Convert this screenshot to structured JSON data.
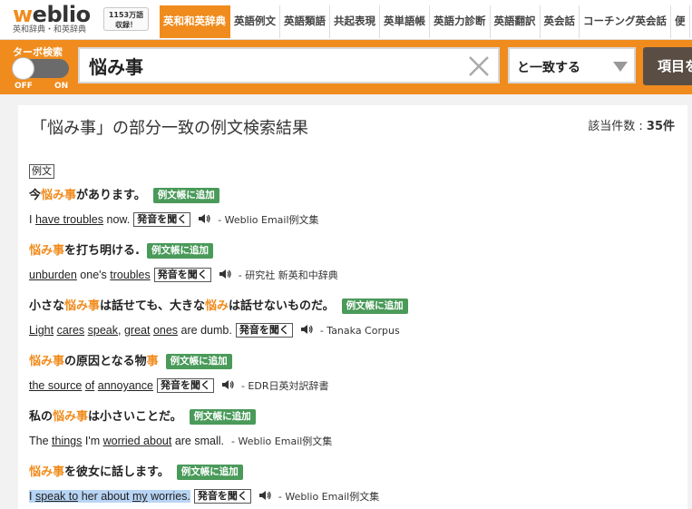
{
  "logo": {
    "brand_w": "w",
    "brand_rest": "eblio",
    "subtitle": "英和辞典・和英辞典"
  },
  "badge": {
    "line1": "1153万語",
    "line2": "収録！"
  },
  "nav": {
    "tabs": [
      "英和和英辞典",
      "英語例文",
      "英語類語",
      "共起表現",
      "英単語帳",
      "英語力診断",
      "英語翻訳",
      "英会話",
      "コーチング英会話",
      "便"
    ],
    "active_index": 0
  },
  "search": {
    "turbo_label": "ターボ検索",
    "toggle_off": "OFF",
    "toggle_on": "ON",
    "turbo_state": "off",
    "query": "悩み事",
    "match_mode": "と一致する",
    "item_button": "項目を"
  },
  "results": {
    "title": "「悩み事」の部分一致の例文検索結果",
    "count_label": "該当件数 : ",
    "count_value": "35件",
    "section_label": "例文",
    "add_label": "例文帳に追加",
    "listen_label": "発音を聞く",
    "entries": [
      {
        "jp": [
          {
            "t": "今"
          },
          {
            "t": "悩み事",
            "hl": true
          },
          {
            "t": "があります。"
          }
        ],
        "en": [
          {
            "t": "I "
          },
          {
            "t": "have troubles",
            "u": true
          },
          {
            "t": " now."
          }
        ],
        "source": "- Weblio Email例文集"
      },
      {
        "jp": [
          {
            "t": "悩み事",
            "hl": true
          },
          {
            "t": "を打ち明ける."
          }
        ],
        "en": [
          {
            "t": "unburden",
            "u": true
          },
          {
            "t": " one's "
          },
          {
            "t": "troubles",
            "u": true
          }
        ],
        "source": "- 研究社 新英和中辞典"
      },
      {
        "jp": [
          {
            "t": "小さな"
          },
          {
            "t": "悩み事",
            "hl": true
          },
          {
            "t": "は話せても、大きな"
          },
          {
            "t": "悩み",
            "hl": true
          },
          {
            "t": "は話せないものだ。"
          }
        ],
        "en": [
          {
            "t": "Light",
            "u": true
          },
          {
            "t": " "
          },
          {
            "t": "cares",
            "u": true
          },
          {
            "t": " "
          },
          {
            "t": "speak",
            "u": true
          },
          {
            "t": ", "
          },
          {
            "t": "great",
            "u": true
          },
          {
            "t": " "
          },
          {
            "t": "ones",
            "u": true
          },
          {
            "t": " are dumb."
          }
        ],
        "source": "- Tanaka Corpus"
      },
      {
        "jp": [
          {
            "t": "悩み事",
            "hl": true
          },
          {
            "t": "の原因となる物"
          },
          {
            "t": "事",
            "hl": true
          }
        ],
        "en": [
          {
            "t": "the source",
            "u": true
          },
          {
            "t": " "
          },
          {
            "t": "of",
            "u": true
          },
          {
            "t": " "
          },
          {
            "t": "annoyance",
            "u": true
          }
        ],
        "source": "- EDR日英対訳辞書"
      },
      {
        "jp": [
          {
            "t": "私の"
          },
          {
            "t": "悩み事",
            "hl": true
          },
          {
            "t": "は小さいことだ。"
          }
        ],
        "en": [
          {
            "t": "The "
          },
          {
            "t": "things",
            "u": true
          },
          {
            "t": " I'm "
          },
          {
            "t": "worried about",
            "u": true
          },
          {
            "t": " are small."
          }
        ],
        "source": "- Weblio Email例文集",
        "no_listen": true
      },
      {
        "jp": [
          {
            "t": "悩み事",
            "hl": true
          },
          {
            "t": "を彼女に話します。"
          }
        ],
        "en": [
          {
            "t": "I ",
            "sel": true
          },
          {
            "t": "speak to",
            "u": true,
            "sel": true
          },
          {
            "t": " her about ",
            "sel": true
          },
          {
            "t": "my",
            "u": true,
            "sel": true
          },
          {
            "t": " worries.",
            "sel": true
          }
        ],
        "source": "- Weblio Email例文集"
      }
    ]
  },
  "colors": {
    "accent": "#f08c1e",
    "add_button": "#4a9a5a",
    "item_button": "#5a4e44",
    "selection": "#b8d4f4"
  }
}
